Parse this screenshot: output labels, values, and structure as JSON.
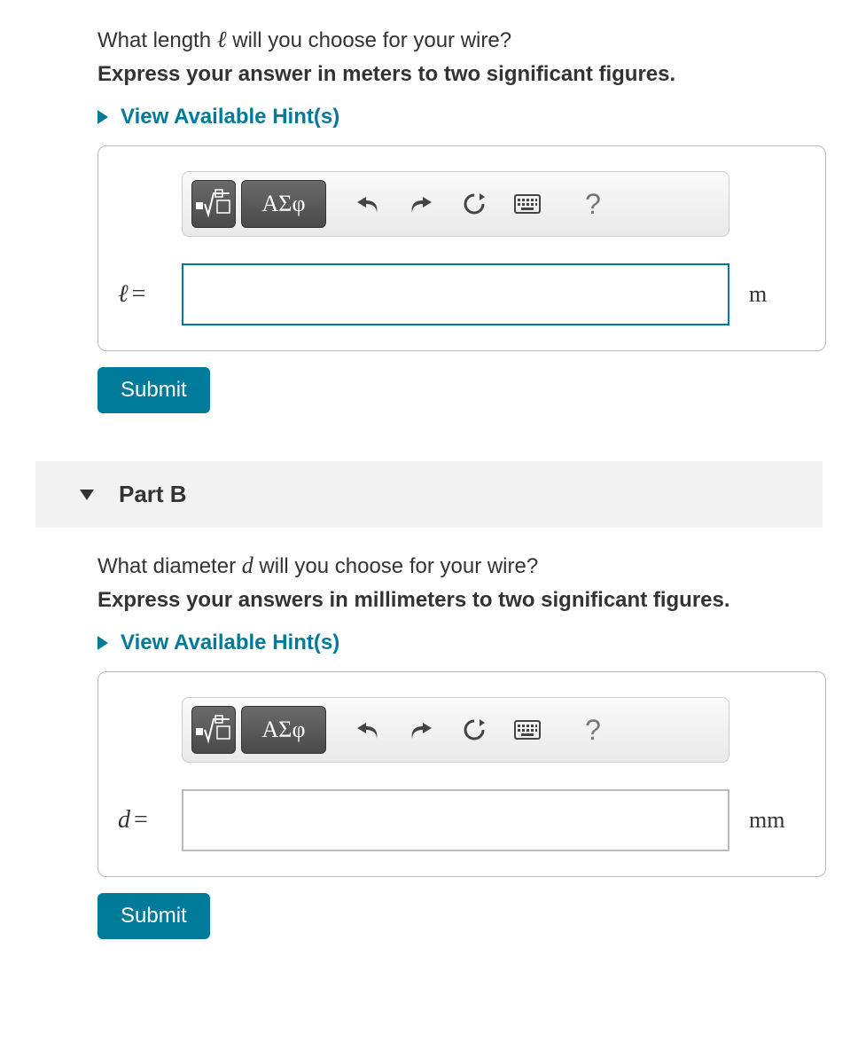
{
  "partA": {
    "question_pre": "What length ",
    "question_var": "ℓ",
    "question_post": " will you choose for your wire?",
    "instruction": "Express your answer in meters to two significant figures.",
    "hints_label": "View Available Hint(s)",
    "toolbar": {
      "greek": "ΑΣφ",
      "help": "?"
    },
    "var": "ℓ",
    "eq": "=",
    "unit": "m",
    "submit": "Submit"
  },
  "partB": {
    "header": "Part B",
    "question_pre": "What diameter ",
    "question_var": "d",
    "question_post": " will you choose for your wire?",
    "instruction": "Express your answers in millimeters to two significant figures.",
    "hints_label": "View Available Hint(s)",
    "toolbar": {
      "greek": "ΑΣφ",
      "help": "?"
    },
    "var": "d",
    "eq": "=",
    "unit": "mm",
    "submit": "Submit"
  }
}
